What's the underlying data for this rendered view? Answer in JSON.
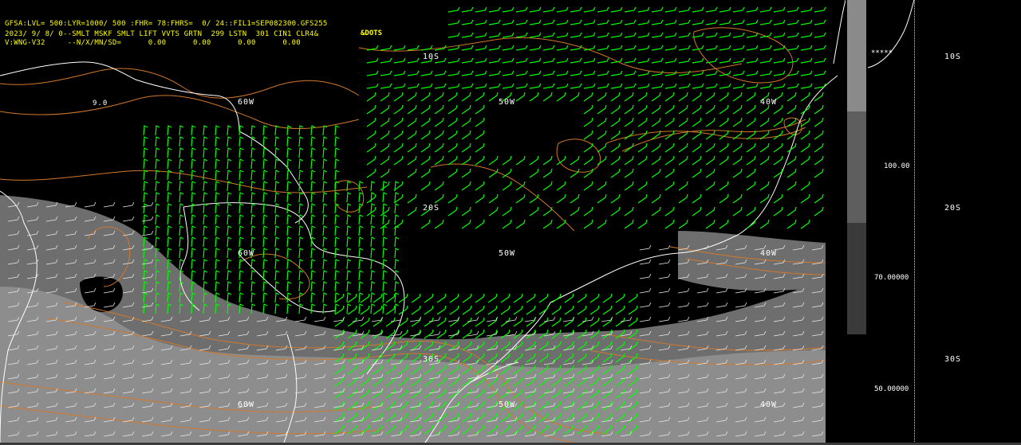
{
  "header": {
    "line1": "GFSA:LVL= 500:LYR=1000/ 500 :FHR= 78:FHRS=  0/ 24::FIL1=SEP082300.GFS255",
    "line2": "2023/ 9/ 8/ 0--SMLT MSKF SMLT LIFT VVTS GRTN  299 LSTN  301 CIN1 CLR4&",
    "line3": "V:WNG-V32     --N/X/MN/SD=      0.00      0.00      0.00      0.00",
    "dots": "&DOTS"
  },
  "grid_labels": {
    "lat_10s": "10S",
    "lat_20s": "20S",
    "lat_30s": "30S",
    "lon_60w": "60W",
    "lon_50w": "50W",
    "lon_40w": "40W",
    "small_label": "9.0"
  },
  "legend": {
    "levels": [
      "100.00",
      "70.00000",
      "50.00000"
    ],
    "shades": [
      "#8a8a8a",
      "#5e5e5e",
      "#3a3a3a"
    ]
  },
  "side_panel": {
    "lat_labels": [
      "10S",
      "20S",
      "30S"
    ],
    "stars": "*****"
  },
  "colors": {
    "wind_barbs": "#00ff00",
    "contours": "#d2782a",
    "coastline": "#ffffff",
    "header_text": "#ffff00"
  }
}
